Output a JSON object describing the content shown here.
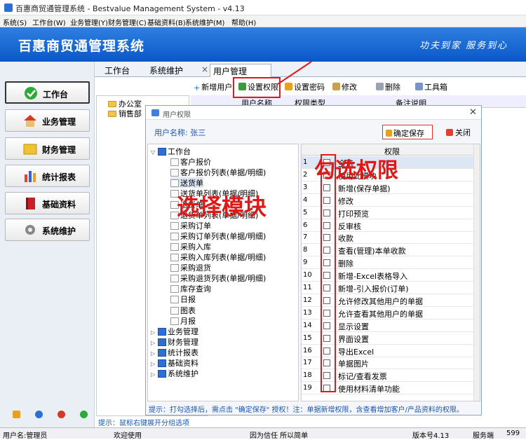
{
  "window": {
    "title": "百惠商贸通管理系统 - Bestvalue Management System - v4.13"
  },
  "menu": [
    "系统(S)",
    "工作台(W)",
    "业务管理(Y)",
    "财务管理(C)",
    "基础资料(B)",
    "系统维护(M)",
    "帮助(H)"
  ],
  "banner": {
    "title": "百惠商贸通管理系统",
    "slogan": "功夫到家  服务到心"
  },
  "nav": [
    {
      "label": "工作台",
      "icon": "check-circle-icon"
    },
    {
      "label": "业务管理",
      "icon": "house-icon"
    },
    {
      "label": "财务管理",
      "icon": "folder-icon"
    },
    {
      "label": "统计报表",
      "icon": "bar-chart-icon"
    },
    {
      "label": "基础资料",
      "icon": "book-icon"
    },
    {
      "label": "系统维护",
      "icon": "gear-icon"
    }
  ],
  "tabs": [
    "工作台",
    "系统维护",
    "用户管理"
  ],
  "toolbar": {
    "new_user": "新增用户",
    "set_perm": "设置权限",
    "set_pwd": "设置密码",
    "edit": "修改",
    "delete": "删除",
    "toolbox": "工具箱"
  },
  "depts": [
    "办公室",
    "销售部"
  ],
  "user_grid_headers": [
    "用户名称",
    "权限类型",
    "备注说明"
  ],
  "dialog": {
    "title": "用户权限",
    "user_label": "用户名称: 张三",
    "save": "确定保存",
    "close": "关闭",
    "hint": "提示：打勾选择后，需点击 \"确定保存\" 授权！注：单据新增权限，含查看增加客户/产品资料的权限。"
  },
  "tree": {
    "root": "工作台",
    "children": [
      "客户报价",
      "客户报价列表(单据/明细)",
      "送货单",
      "送货单列表(单据/明细)",
      "退货单",
      "退货单列表(单据/明细)",
      "采购订单",
      "采购订单列表(单据/明细)",
      "采购入库",
      "采购入库列表(单据/明细)",
      "采购退货",
      "采购退货列表(单据/明细)",
      "库存查询",
      "日报",
      "图表",
      "月报"
    ],
    "groups": [
      "业务管理",
      "财务管理",
      "统计报表",
      "基础资料",
      "系统维护"
    ]
  },
  "grid": {
    "header": "权限",
    "rows": [
      "全选",
      "使用此模块",
      "新增(保存单据)",
      "修改",
      "打印预览",
      "反审核",
      "收款",
      "查看(管理)本单收款",
      "删除",
      "新增-Excel表格导入",
      "新增-引入报价(订单)",
      "允许修改其他用户的单据",
      "允许查看其他用户的单据",
      "显示设置",
      "界面设置",
      "导出Excel",
      "单据图片",
      "标记/查看发票",
      "使用材料清单功能"
    ]
  },
  "annotations": {
    "module": "选择模块",
    "perm": "勾选权限"
  },
  "status_tip": "提示：鼠标右键展开分组选项",
  "statusbar": {
    "user": "用户名:管理员",
    "welcome": "欢迎使用",
    "motto": "因为信任 所以简单",
    "version": "版本号4.13",
    "server": "服务端",
    "num": "599"
  }
}
